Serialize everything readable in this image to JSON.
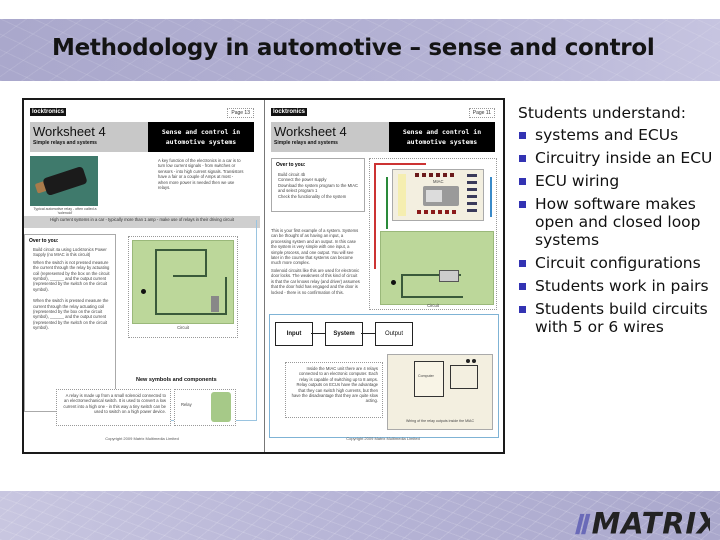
{
  "slide": {
    "title": "Methodology in automotive – sense and control"
  },
  "worksheets": {
    "left": {
      "brand": "locktronics",
      "page_label": "Page 13",
      "title": "Worksheet 4",
      "subtitle": "Simple relays and systems",
      "header_black": "Sense and control in automotive systems",
      "intro_text": "A key function of the electronics in a car is to turn low current signals - from switches or sensors - into high current signals. Transistors have a fair or a couple of Amps at most - when more power is needed then we use relays.",
      "photo_caption": "Typical automotive relay - often called a 'solenoid'",
      "grey_bar": "High current systems in a car - typically more than 1 amp - make use of relays in their driving circuit",
      "over_to_you": "Over to you:",
      "steps": [
        "Build circuit 4a using Locktronics Power Supply (no MIAC in this circuit)",
        "When the switch is not pressed measure the current through the relay by actuating coil (represented by the box on the circuit symbol), ______ and the output current (represented by the switch on the circuit symbol).",
        "When the switch is pressed measure the current through the relay actuating coil (represented by the box on the circuit symbol), ______ and the output current (represented by the switch on the circuit symbol)."
      ],
      "diagram_caption": "Circuit",
      "new_symbols": "New symbols and components",
      "relay_text": "A relay is made up from a small solenoid connected to an electromechanical switch. It is used to convert a low current into a high one - in this way a tiny switch can be used to switch on a high power device.",
      "relay_label": "Relay",
      "copyright": "Copyright 2009 Matrix Multimedia Limited"
    },
    "right": {
      "brand": "locktronics",
      "page_label": "Page 11",
      "title": "Worksheet 4",
      "subtitle": "Simple relays and systems",
      "header_black": "Sense and control in automotive systems",
      "over_to_you": "Over to you:",
      "steps": [
        "Build circuit 4b",
        "Connect the power supply",
        "Download the system program to the MIAC and select program 1",
        "Check the functionality of the system"
      ],
      "miac_label": "MIAC",
      "body_text_1": "This is your first example of a system. Systems can be thought of as having an input, a processing system and an output. In this case the system is very simple with one input, a simple process, and one output. You will see later in the course that systems can become much more complex.",
      "body_text_2": "Solenoid circuits like this are used for electronic door locks. The weakness of this kind of circuit is that the car knows relay (and driver) assumes that the door hold has engaged and the door is locked - there is no confirmation of this.",
      "diagram_caption": "Circuit",
      "flow": [
        "Input",
        "System",
        "Output"
      ],
      "relay_text": "Inside the MIAC unit there are 4 relays connected to an electronic computer. Each relay is capable of switching up to 8 amps. Relay outputs on ECUs have the advantage that they can switch high currents, but then have the disadvantage that they are quite slow acting.",
      "computer_label": "Computer",
      "wiring_caption": "Wiring of the relay outputs inside the MIAC",
      "copyright": "Copyright 2009 Matrix Multimedia Limited"
    }
  },
  "bullets": {
    "lead": "Students understand:",
    "items": [
      "systems and ECUs",
      "Circuitry inside an ECU",
      "ECU wiring",
      "How software makes open and closed loop systems",
      "Circuit configurations",
      "Students work in pairs",
      "Students build circuits with 5 or 6 wires"
    ],
    "bullet_color": "#3333b3"
  },
  "footer": {
    "logo": "MATRIX"
  },
  "colors": {
    "band": "#b4b2d4",
    "bullet": "#3333b3"
  }
}
